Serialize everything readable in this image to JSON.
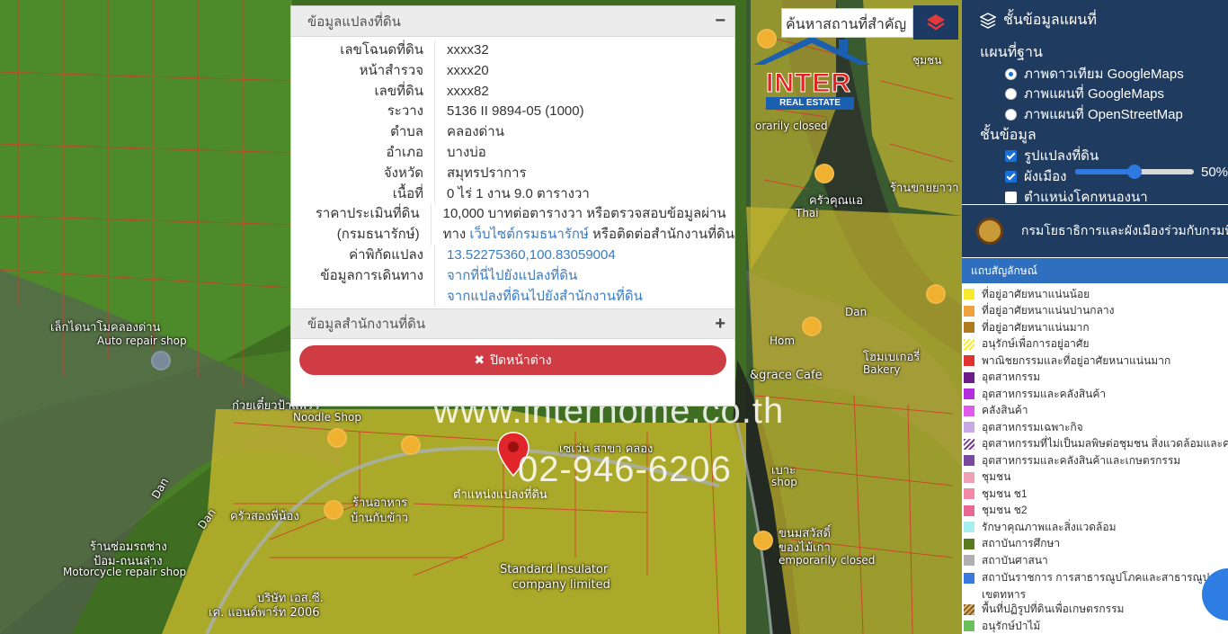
{
  "info_panel": {
    "header": "ข้อมูลแปลงที่ดิน",
    "collapse_symbol": "−",
    "rows": [
      {
        "label": "เลขโฉนดที่ดิน",
        "value": "xxxx32"
      },
      {
        "label": "หน้าสำรวจ",
        "value": "xxxx20"
      },
      {
        "label": "เลขที่ดิน",
        "value": "xxxx82"
      },
      {
        "label": "ระวาง",
        "value": "5136 II 9894-05 (1000)"
      },
      {
        "label": "ตำบล",
        "value": "คลองด่าน"
      },
      {
        "label": "อำเภอ",
        "value": "บางบ่อ"
      },
      {
        "label": "จังหวัด",
        "value": "สมุทรปราการ"
      },
      {
        "label": "เนื้อที่",
        "value": "0 ไร่ 1 งาน 9.0 ตารางวา"
      }
    ],
    "price": {
      "label_line1": "ราคาประเมินที่ดิน",
      "label_line2": "(กรมธนารักษ์)",
      "value_line1": "10,000 บาทต่อตารางวา หรือตรวจสอบข้อมูลผ่าน",
      "value_line2_prefix": "ทาง",
      "value_line2_link": "เว็บไซต์กรมธนารักษ์",
      "value_line2_suffix": "หรือติดต่อสำนักงานที่ดิน"
    },
    "coords": {
      "label": "ค่าพิกัดแปลง",
      "value": "13.52275360,100.83059004"
    },
    "travel": {
      "label": "ข้อมูลการเดินทาง",
      "link1": "จากที่นี่ไปยังแปลงที่ดิน",
      "link2": "จากแปลงที่ดินไปยังสำนักงานที่ดิน"
    },
    "office_header": "ข้อมูลสำนักงานที่ดิน",
    "expand_symbol": "+",
    "close_icon": "✖",
    "close_label": "ปิดหน้าต่าง"
  },
  "search": {
    "placeholder": "ค้นหาสถานที่สำคัญ"
  },
  "logo": {
    "name": "INTER",
    "sub": "REAL ESTATE"
  },
  "watermark": {
    "url": "www.interhome.co.th",
    "phone": "02-946-6206"
  },
  "map": {
    "pin_label": "ตำแหน่งแปลงที่ดิน",
    "labels": [
      "เล็กไดนาโมคลองด่าน",
      "Auto repair shop",
      "ก๋วยเตี๋ยวป้าแพรว",
      "Noodle Shop",
      "ครัวสองพี่น้อง",
      "ร้านซ่อมรถช่าง",
      "ป้อม-ถนนล่าง",
      "Motorcycle repair shop",
      "Dan",
      "Dan",
      "Dan",
      "Hom",
      "&grace Cafe",
      "โฮมเบเกอรี่",
      "Bakery",
      "ครัวคุณแอ",
      "Thai",
      "ร้านขายยาวา",
      "orarily closed",
      "Standard Insulator",
      "company limited",
      "บริษัท เอส.ซี.",
      "เค. แอนด์พาร์ท 2006",
      "เซเว่น สาขา คลอง",
      "เบาะ",
      "shop",
      "ร้านอาหาร",
      "บ้านกับข้าว",
      "ขนมสวัสดิ์",
      "ของไม้เก่า",
      "emporarily closed",
      "ชุมชน"
    ]
  },
  "sidebar": {
    "layers_title": "ชั้นข้อมูลแผนที่",
    "basemap_title": "แผนที่ฐาน",
    "basemaps": [
      {
        "label": "ภาพดาวเทียม GoogleMaps",
        "selected": true
      },
      {
        "label": "ภาพแผนที่ GoogleMaps",
        "selected": false
      },
      {
        "label": "ภาพแผนที่ OpenStreetMap",
        "selected": false
      }
    ],
    "data_title": "ชั้นข้อมูล",
    "layers": [
      {
        "label": "รูปแปลงที่ดิน",
        "checked": true
      },
      {
        "label": "ผังเมือง",
        "checked": true
      },
      {
        "label": "ตำแหน่งโคกหนองนา",
        "checked": false
      }
    ],
    "opacity_value": 50,
    "opacity_text": "50%",
    "department": "กรมโยธาธิการและผังเมืองร่วมกับกรมที่ดิน",
    "legend_title": "แถบสัญลักษณ์",
    "legend": [
      {
        "label": "ที่อยู่อาศัยหนาแน่นน้อย",
        "color": "#f5ea2e"
      },
      {
        "label": "ที่อยู่อาศัยหนาแน่นปานกลาง",
        "color": "#f0a03c"
      },
      {
        "label": "ที่อยู่อาศัยหนาแน่นมาก",
        "color": "#b07a1e"
      },
      {
        "label": "อนุรักษ์เพื่อการอยู่อาศัย",
        "color": "#f5ea2e"
      },
      {
        "label": "พาณิชยกรรมและที่อยู่อาศัยหนาแน่นมาก",
        "color": "#e0322e"
      },
      {
        "label": "อุตสาหกรรม",
        "color": "#6b1e8a"
      },
      {
        "label": "อุตสาหกรรมและคลังสินค้า",
        "color": "#b42ee0"
      },
      {
        "label": "คลังสินค้า",
        "color": "#e05aea"
      },
      {
        "label": "อุตสาหกรรมเฉพาะกิจ",
        "color": "#c8a8e6"
      },
      {
        "label": "อุตสาหกรรมที่ไม่เป็นมลพิษต่อชุมชน สิ่งแวดล้อมและคลังสินค้า",
        "color": "#7a3a9a"
      },
      {
        "label": "อุตสาหกรรมและคลังสินค้าและเกษตรกรรม",
        "color": "#7a4aa0"
      },
      {
        "label": "ชุมชน",
        "color": "#f0a0b4"
      },
      {
        "label": "ชุมชน ช1",
        "color": "#f08aa6"
      },
      {
        "label": "ชุมชน ช2",
        "color": "#e86a92"
      },
      {
        "label": "รักษาคุณภาพและสิ่งแวดล้อม",
        "color": "#a8f0f0"
      },
      {
        "label": "สถาบันการศึกษา",
        "color": "#5a7a1e"
      },
      {
        "label": "สถาบันศาสนา",
        "color": "#b0b0b0"
      },
      {
        "label": "สถาบันราชการ การสาธารณูปโภคและสาธารณูปการ",
        "label2": "เขตทหาร",
        "color": "#3a7ae0"
      },
      {
        "label": "พื้นที่ปฏิรูปที่ดินเพื่อเกษตรกรรม",
        "color": "#8a5a1e"
      },
      {
        "label": "อนุรักษ์ป่าไม้",
        "color": "#6ac05a"
      }
    ]
  },
  "colors": {
    "navy": "#1f3b60",
    "close_red": "#cf3c44",
    "link_blue": "#3b7bbf",
    "zone_yellow": "#d8c830"
  }
}
